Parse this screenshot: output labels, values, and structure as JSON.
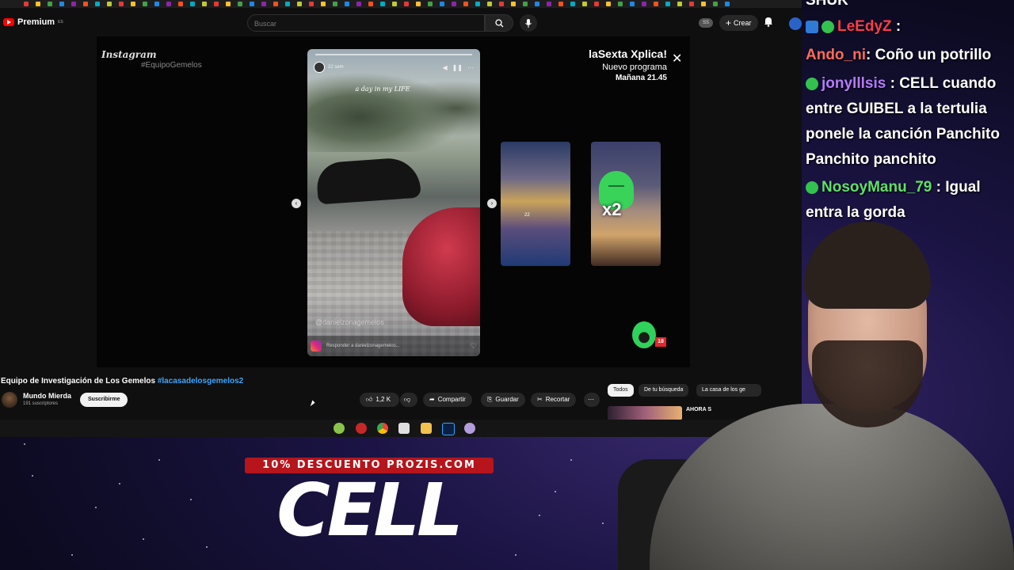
{
  "youtube": {
    "logo_text": "Premium",
    "logo_region": "ES",
    "search_placeholder": "Buscar",
    "ss_badge": "SS",
    "create_label": "Crear"
  },
  "player": {
    "instagram_word": "Instagram",
    "hashtag": "#EquipoGemelos",
    "story_caption": "a day in my LIFE",
    "story_time": "22 sem",
    "story_handle": "@danielzonagemelos",
    "story_reply": "Responder a danielzonagemelos...",
    "thumb1_caption": "22",
    "promo_title": "laSexta Xplica!",
    "promo_line1": "Nuevo programa",
    "promo_line2": "Mañana 21.45",
    "age_rating": "18",
    "multiplier": "x2"
  },
  "video": {
    "title": "Equipo de Investigación de Los Gemelos",
    "title_hashtag": "#lacasadelosgemelos2",
    "channel_name": "Mundo Mierda",
    "channel_subs": "191 suscriptores",
    "subscribe_label": "Suscribirme",
    "likes": "1,2 K",
    "share_label": "Compartir",
    "save_label": "Guardar",
    "clip_label": "Recortar"
  },
  "sidebar": {
    "chips": [
      "Todos",
      "De tu búsqueda",
      "La casa de los ge"
    ],
    "suggestion_text": "AHORA S"
  },
  "chat": {
    "header_partial": "SHUK",
    "messages": [
      {
        "user": "LeEdyZ",
        "text": ":",
        "color": "#ff3b4e"
      },
      {
        "user": "Ando_ni",
        "text": ": Coño un potrillo",
        "color": "#ff6b5e"
      },
      {
        "user": "jonylllsis",
        "text": ": CELL cuando entre GUIBEL a la tertulia ponele la canción Panchito Panchito panchito",
        "color": "#b57bff"
      },
      {
        "user": "NosoyManu_79",
        "text": ": Igual entra la gorda",
        "color": "#5fe06a"
      }
    ]
  },
  "overlay": {
    "discount_text": "10% DESCUENTO PROZIS.COM",
    "brand_text": "CELL"
  },
  "colors": {
    "youtube_red": "#ff0000",
    "link_blue": "#3ea6ff",
    "promo_red": "#b5151b",
    "lasexta_green": "#2fd25a"
  }
}
